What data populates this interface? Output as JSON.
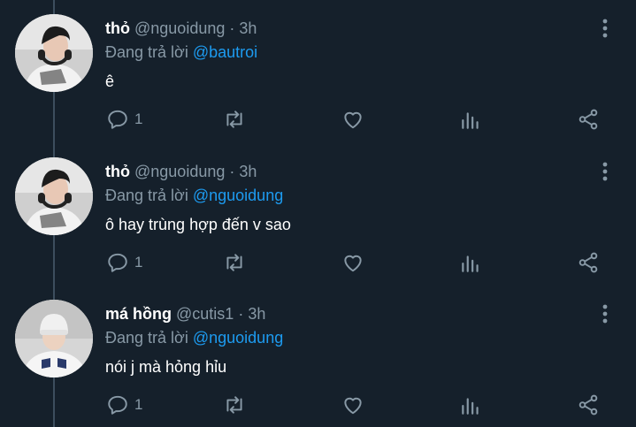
{
  "tweets": [
    {
      "name": "thỏ",
      "handle": "@nguoidung",
      "separator": "·",
      "time": "3h",
      "reply_label": "Đang trả lời",
      "reply_mention": "@bautroi",
      "text": "ê",
      "reply_count": "1",
      "avatar_type": "photo-boy-headphones"
    },
    {
      "name": "thỏ",
      "handle": "@nguoidung",
      "separator": "·",
      "time": "3h",
      "reply_label": "Đang trả lời",
      "reply_mention": "@nguoidung",
      "text": "ô hay trùng hợp đến v sao",
      "reply_count": "1",
      "avatar_type": "photo-boy-headphones"
    },
    {
      "name": "má hồng",
      "handle": "@cutis1",
      "separator": "·",
      "time": "3h",
      "reply_label": "Đang trả lời",
      "reply_mention": "@nguoidung",
      "text": "nói j mà hỏng hỉu",
      "reply_count": "1",
      "avatar_type": "photo-boy-beanie"
    }
  ],
  "icons": {
    "reply": "reply-icon",
    "retweet": "retweet-icon",
    "like": "heart-icon",
    "stats": "stats-icon",
    "share": "share-icon",
    "more": "more-vertical-icon"
  },
  "colors": {
    "background": "#15202b",
    "secondary_text": "#8899a6",
    "mention": "#1d9bf0",
    "thread_line": "#3d4e5e"
  }
}
